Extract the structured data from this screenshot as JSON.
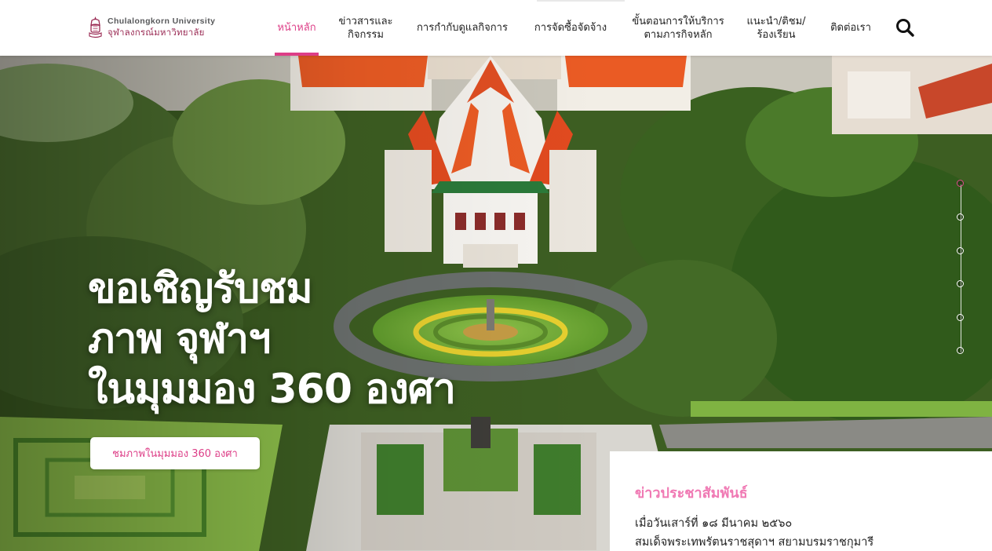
{
  "brand": {
    "name_en": "Chulalongkorn University",
    "name_th": "จุฬาลงกรณ์มหาวิทยาลัย"
  },
  "nav": {
    "items": [
      {
        "label": "หน้าหลัก",
        "active": true
      },
      {
        "label": "ข่าวสารและ\nกิจกรรม",
        "active": false
      },
      {
        "label": "การกำกับดูแลกิจการ",
        "active": false
      },
      {
        "label": "การจัดซื้อจัดจ้าง",
        "active": false
      },
      {
        "label": "ขั้นตอนการให้บริการ\nตามภารกิจหลัก",
        "active": false
      },
      {
        "label": "แนะนำ/ติชม/\nร้องเรียน",
        "active": false
      },
      {
        "label": "ติดต่อเรา",
        "active": false
      }
    ],
    "search_icon": "search-icon",
    "accent_color": "#dd3e87"
  },
  "hero": {
    "title_lines": [
      "ขอเชิญรับชม",
      "ภาพ จุฬาฯ",
      "ในมุมมอง 360 องศา"
    ],
    "cta_label": "ชมภาพในมุมมอง 360 องศา",
    "slides_total": 6,
    "active_slide": 1
  },
  "news": {
    "heading": "ข่าวประชาสัมพันธ์",
    "line1": "เมื่อวันเสาร์ที่ ๑๘  มีนาคม ๒๕๖๐",
    "line2": "สมเด็จพระเทพรัตนราชสุดาฯ สยามบรมราชกุมารี",
    "heading_color": "#f07ab4"
  }
}
